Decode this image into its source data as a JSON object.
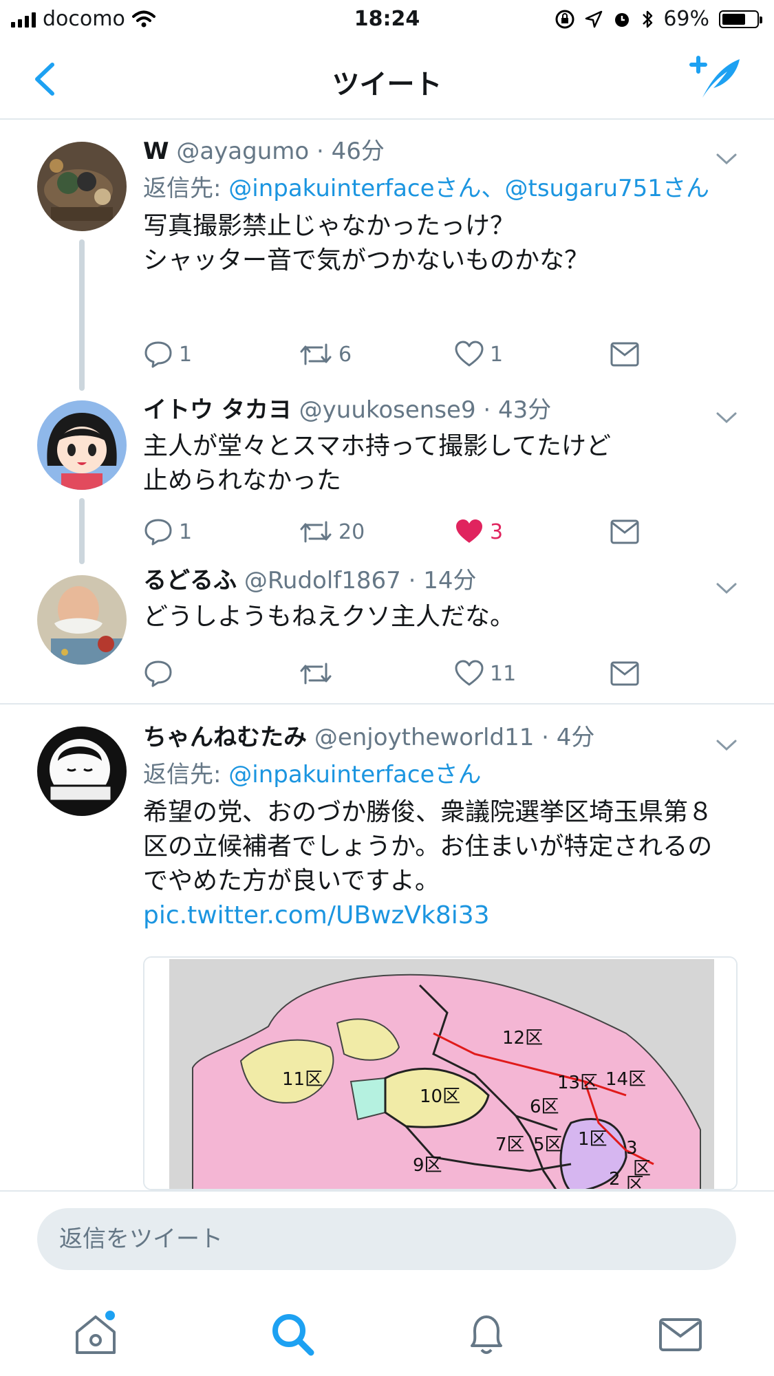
{
  "status_bar": {
    "carrier": "docomo",
    "time": "18:24",
    "battery": "69%",
    "battery_level": 0.69
  },
  "nav": {
    "title": "ツイート",
    "back_icon": "chevron-left-icon",
    "compose_icon": "compose-tweet-icon"
  },
  "tweets": [
    {
      "name": "W",
      "handle": "@ayagumo",
      "time": "· 46分",
      "reply_prefix": "返信先: ",
      "reply_mentions": "@inpakuinterfaceさん、@tsugaru751さん",
      "text": "写真撮影禁止じゃなかったっけ？\nシャッター音で気がつかないものかな？",
      "replies": "1",
      "retweets": "6",
      "likes": "1",
      "liked": false
    },
    {
      "name": "イトウ タカヨ",
      "handle": "@yuukosense9",
      "time": "· 43分",
      "text": "主人が堂々とスマホ持って撮影してたけど\n止められなかった",
      "replies": "1",
      "retweets": "20",
      "likes": "3",
      "liked": true
    },
    {
      "name": "るどるふ",
      "handle": "@Rudolf1867",
      "time": "· 14分",
      "text": "どうしようもねえクソ主人だな。",
      "replies": "",
      "retweets": "",
      "likes": "11",
      "liked": false
    },
    {
      "name": "ちゃんねむたみ",
      "handle": "@enjoytheworld11",
      "time": "· 4分",
      "reply_prefix": "返信先: ",
      "reply_mentions": "@inpakuinterfaceさん",
      "text": "希望の党、おのづか勝俊、衆議院選挙区埼玉県第８区の立候補者でしょうか。お住まいが特定されるのでやめた方が良いですよ。 ",
      "link": "pic.twitter.com/UBwzVk8i33"
    }
  ],
  "map": {
    "districts": [
      "12区",
      "11区",
      "10区",
      "13区",
      "14区",
      "6区",
      "7区",
      "5区",
      "1区",
      "9区",
      "3",
      "区",
      "2",
      "区"
    ]
  },
  "reply_bar": {
    "placeholder": "返信をツイート"
  },
  "tabs": [
    "home-icon",
    "search-icon",
    "notifications-icon",
    "messages-icon"
  ],
  "colors": {
    "accent": "#1da1f2",
    "link": "#1b95e0",
    "like": "#e0245e",
    "muted": "#657786"
  }
}
